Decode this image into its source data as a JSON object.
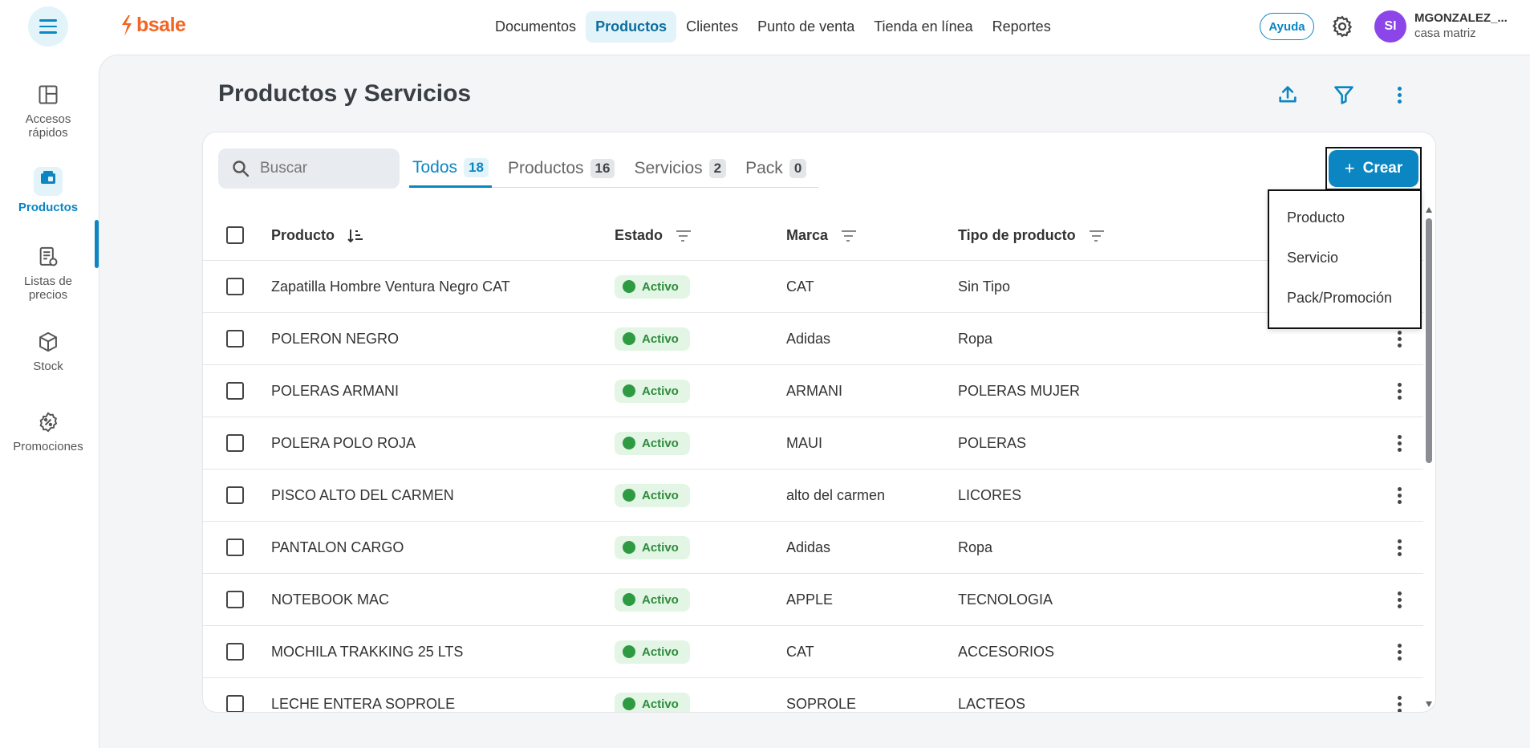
{
  "brand": {
    "name": "bsale"
  },
  "topnav": {
    "items": [
      {
        "label": "Documentos"
      },
      {
        "label": "Productos"
      },
      {
        "label": "Clientes"
      },
      {
        "label": "Punto de venta"
      },
      {
        "label": "Tienda en línea"
      },
      {
        "label": "Reportes"
      }
    ],
    "active": "Productos"
  },
  "header": {
    "help_label": "Ayuda",
    "avatar_initials": "SI",
    "user_name": "MGONZALEZ_...",
    "branch": "casa matriz"
  },
  "sidebar": {
    "items": [
      {
        "label": "Accesos rápidos"
      },
      {
        "label": "Productos"
      },
      {
        "label": "Listas de precios"
      },
      {
        "label": "Stock"
      },
      {
        "label": "Promociones"
      }
    ],
    "active": "Productos"
  },
  "page": {
    "title": "Productos y Servicios"
  },
  "search": {
    "placeholder": "Buscar",
    "value": ""
  },
  "tabs": [
    {
      "label": "Todos",
      "count": "18"
    },
    {
      "label": "Productos",
      "count": "16"
    },
    {
      "label": "Servicios",
      "count": "2"
    },
    {
      "label": "Pack",
      "count": "0"
    }
  ],
  "create_button": {
    "label": "Crear",
    "icon": "+"
  },
  "create_menu": {
    "options": [
      "Producto",
      "Servicio",
      "Pack/Promoción"
    ]
  },
  "table": {
    "columns": [
      "Producto",
      "Estado",
      "Marca",
      "Tipo de producto"
    ],
    "rows": [
      {
        "producto": "Zapatilla Hombre Ventura Negro CAT",
        "estado": "Activo",
        "marca": "CAT",
        "tipo": "Sin Tipo"
      },
      {
        "producto": "POLERON NEGRO",
        "estado": "Activo",
        "marca": "Adidas",
        "tipo": "Ropa"
      },
      {
        "producto": "POLERAS ARMANI",
        "estado": "Activo",
        "marca": "ARMANI",
        "tipo": "POLERAS MUJER"
      },
      {
        "producto": "POLERA POLO ROJA",
        "estado": "Activo",
        "marca": "MAUI",
        "tipo": "POLERAS"
      },
      {
        "producto": "PISCO ALTO DEL CARMEN",
        "estado": "Activo",
        "marca": "alto del carmen",
        "tipo": "LICORES"
      },
      {
        "producto": "PANTALON CARGO",
        "estado": "Activo",
        "marca": "Adidas",
        "tipo": "Ropa"
      },
      {
        "producto": "NOTEBOOK MAC",
        "estado": "Activo",
        "marca": "APPLE",
        "tipo": "TECNOLOGIA"
      },
      {
        "producto": "MOCHILA TRAKKING 25 LTS",
        "estado": "Activo",
        "marca": "CAT",
        "tipo": "ACCESORIOS"
      },
      {
        "producto": "LECHE ENTERA SOPROLE",
        "estado": "Activo",
        "marca": "SOPROLE",
        "tipo": "LACTEOS"
      }
    ]
  },
  "colors": {
    "accent": "#0b86c3",
    "brand": "#f26522",
    "active_badge": "#2e8b3e"
  }
}
